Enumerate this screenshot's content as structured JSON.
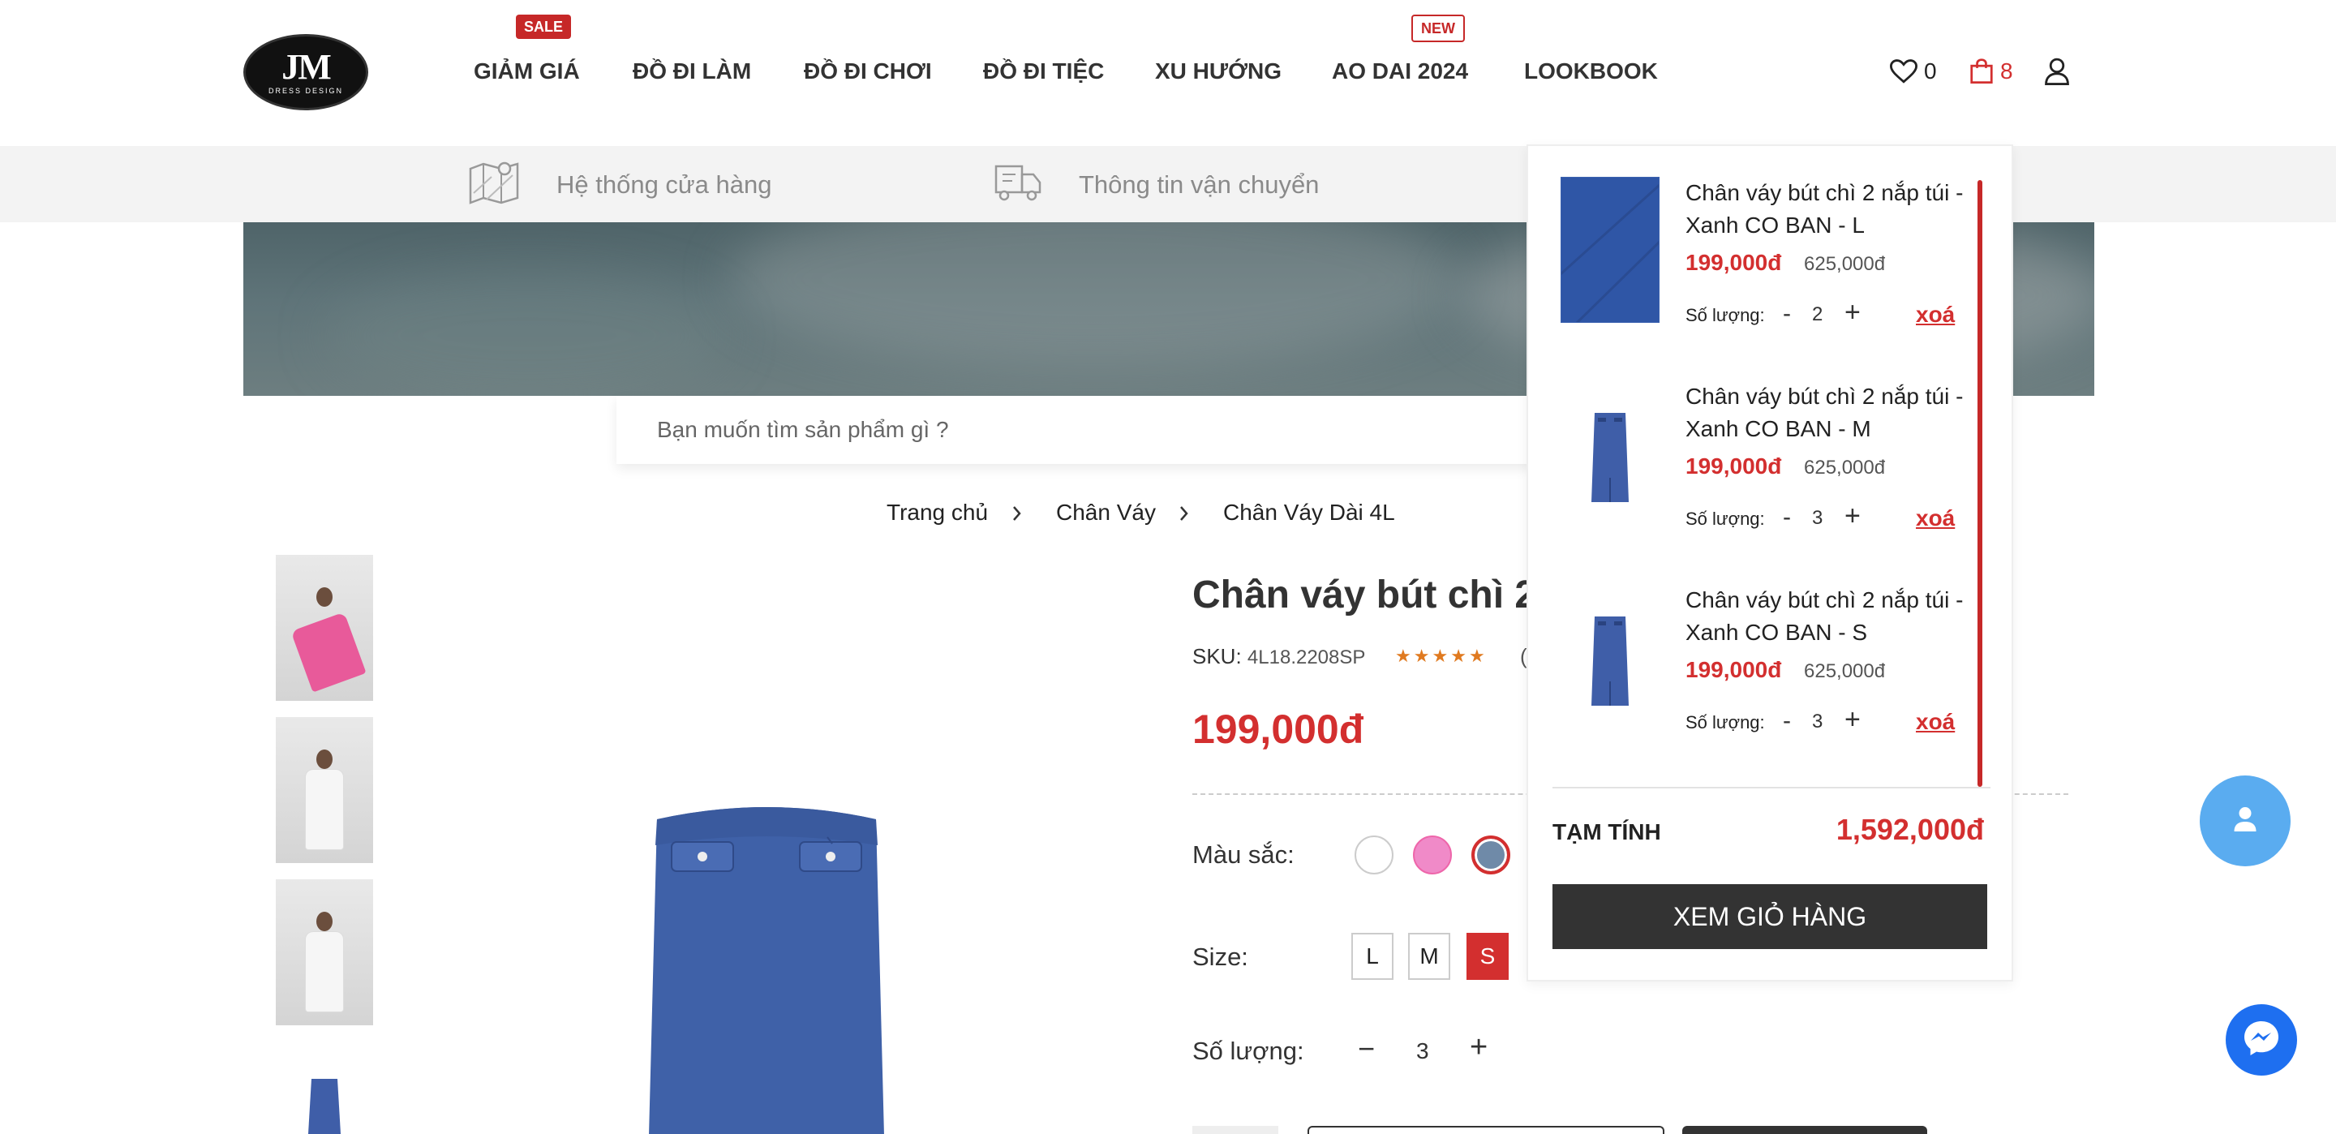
{
  "header": {
    "logo_text": "JM",
    "logo_sub": "DRESS DESIGN",
    "nav": [
      {
        "label": "GIẢM GIÁ",
        "badge": "SALE"
      },
      {
        "label": "ĐỒ ĐI LÀM"
      },
      {
        "label": "ĐỒ ĐI CHƠI"
      },
      {
        "label": "ĐỒ ĐI TIỆC"
      },
      {
        "label": "XU HƯỚNG"
      },
      {
        "label": "AO DAI 2024",
        "badge": "NEW"
      },
      {
        "label": "LOOKBOOK"
      }
    ],
    "wishlist_count": "0",
    "cart_count": "8",
    "icons": {
      "wishlist": "heart-icon",
      "cart": "shopping-bag-icon",
      "account": "user-icon"
    }
  },
  "infobar": {
    "store_system": "Hệ thống cửa hàng",
    "shipping_info": "Thông tin vận chuyển"
  },
  "search": {
    "placeholder": "Bạn muốn tìm sản phẩm gì ?"
  },
  "breadcrumb": [
    "Trang chủ",
    "Chân Váy",
    "Chân Váy Dài 4L"
  ],
  "product": {
    "title": "Chân váy bút chì 2 nắp túi - Xanh CO BAN",
    "sku_label": "SKU:",
    "sku": "4L18.2208SP",
    "rating_stars": 5,
    "price": "199,000đ",
    "color_label": "Màu sắc:",
    "colors": [
      "#ffffff",
      "#f08ac8",
      "#6f8aa8"
    ],
    "selected_color_index": 2,
    "size_label": "Size:",
    "sizes": [
      "L",
      "M",
      "S"
    ],
    "selected_size": "S",
    "qty_label": "Số lượng:",
    "qty": "3"
  },
  "cart": {
    "items": [
      {
        "name": "Chân váy bút chì 2 nắp túi - Xanh CO BAN - L",
        "price": "199,000đ",
        "old_price": "625,000đ",
        "qty_label": "Số lượng:",
        "qty": "2",
        "remove": "xoá"
      },
      {
        "name": "Chân váy bút chì 2 nắp túi - Xanh CO BAN - M",
        "price": "199,000đ",
        "old_price": "625,000đ",
        "qty_label": "Số lượng:",
        "qty": "3",
        "remove": "xoá"
      },
      {
        "name": "Chân váy bút chì 2 nắp túi - Xanh CO BAN - S",
        "price": "199,000đ",
        "old_price": "625,000đ",
        "qty_label": "Số lượng:",
        "qty": "3",
        "remove": "xoá"
      }
    ],
    "subtotal_label": "TẠM TÍNH",
    "subtotal": "1,592,000đ",
    "view_cart": "XEM GIỎ HÀNG"
  },
  "colors": {
    "accent": "#d32f2f",
    "dark_button": "#333333",
    "fab_user": "#5aacf0",
    "fab_messenger": "#1e6ff0"
  }
}
